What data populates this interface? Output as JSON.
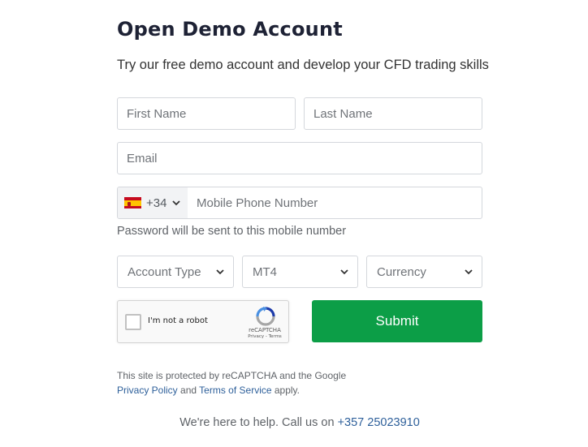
{
  "header": {
    "title": "Open Demo Account",
    "subtitle": "Try our free demo account and develop your CFD trading skills"
  },
  "form": {
    "first_name_placeholder": "First Name",
    "last_name_placeholder": "Last Name",
    "email_placeholder": "Email",
    "phone": {
      "country_flag": "spain-flag-icon",
      "country_code": "+34",
      "placeholder": "Mobile Phone Number",
      "hint": "Password will be sent to this mobile number"
    },
    "selects": {
      "account_type": "Account Type",
      "platform": "MT4",
      "currency": "Currency"
    },
    "captcha": {
      "label": "I'm not a robot",
      "brand": "reCAPTCHA",
      "privacy": "Privacy",
      "separator": " - ",
      "terms": "Terms"
    },
    "submit_label": "Submit"
  },
  "legal": {
    "line1": "This site is protected by reCAPTCHA and the Google",
    "privacy_link": "Privacy Policy",
    "and": " and ",
    "terms_link": "Terms of Service",
    "apply": " apply."
  },
  "help": {
    "text": "We're here to help. Call us on ",
    "phone": "+357 25023910"
  },
  "colors": {
    "submit_bg": "#0c9e47",
    "link": "#2d5f9a",
    "title": "#1e2235"
  }
}
